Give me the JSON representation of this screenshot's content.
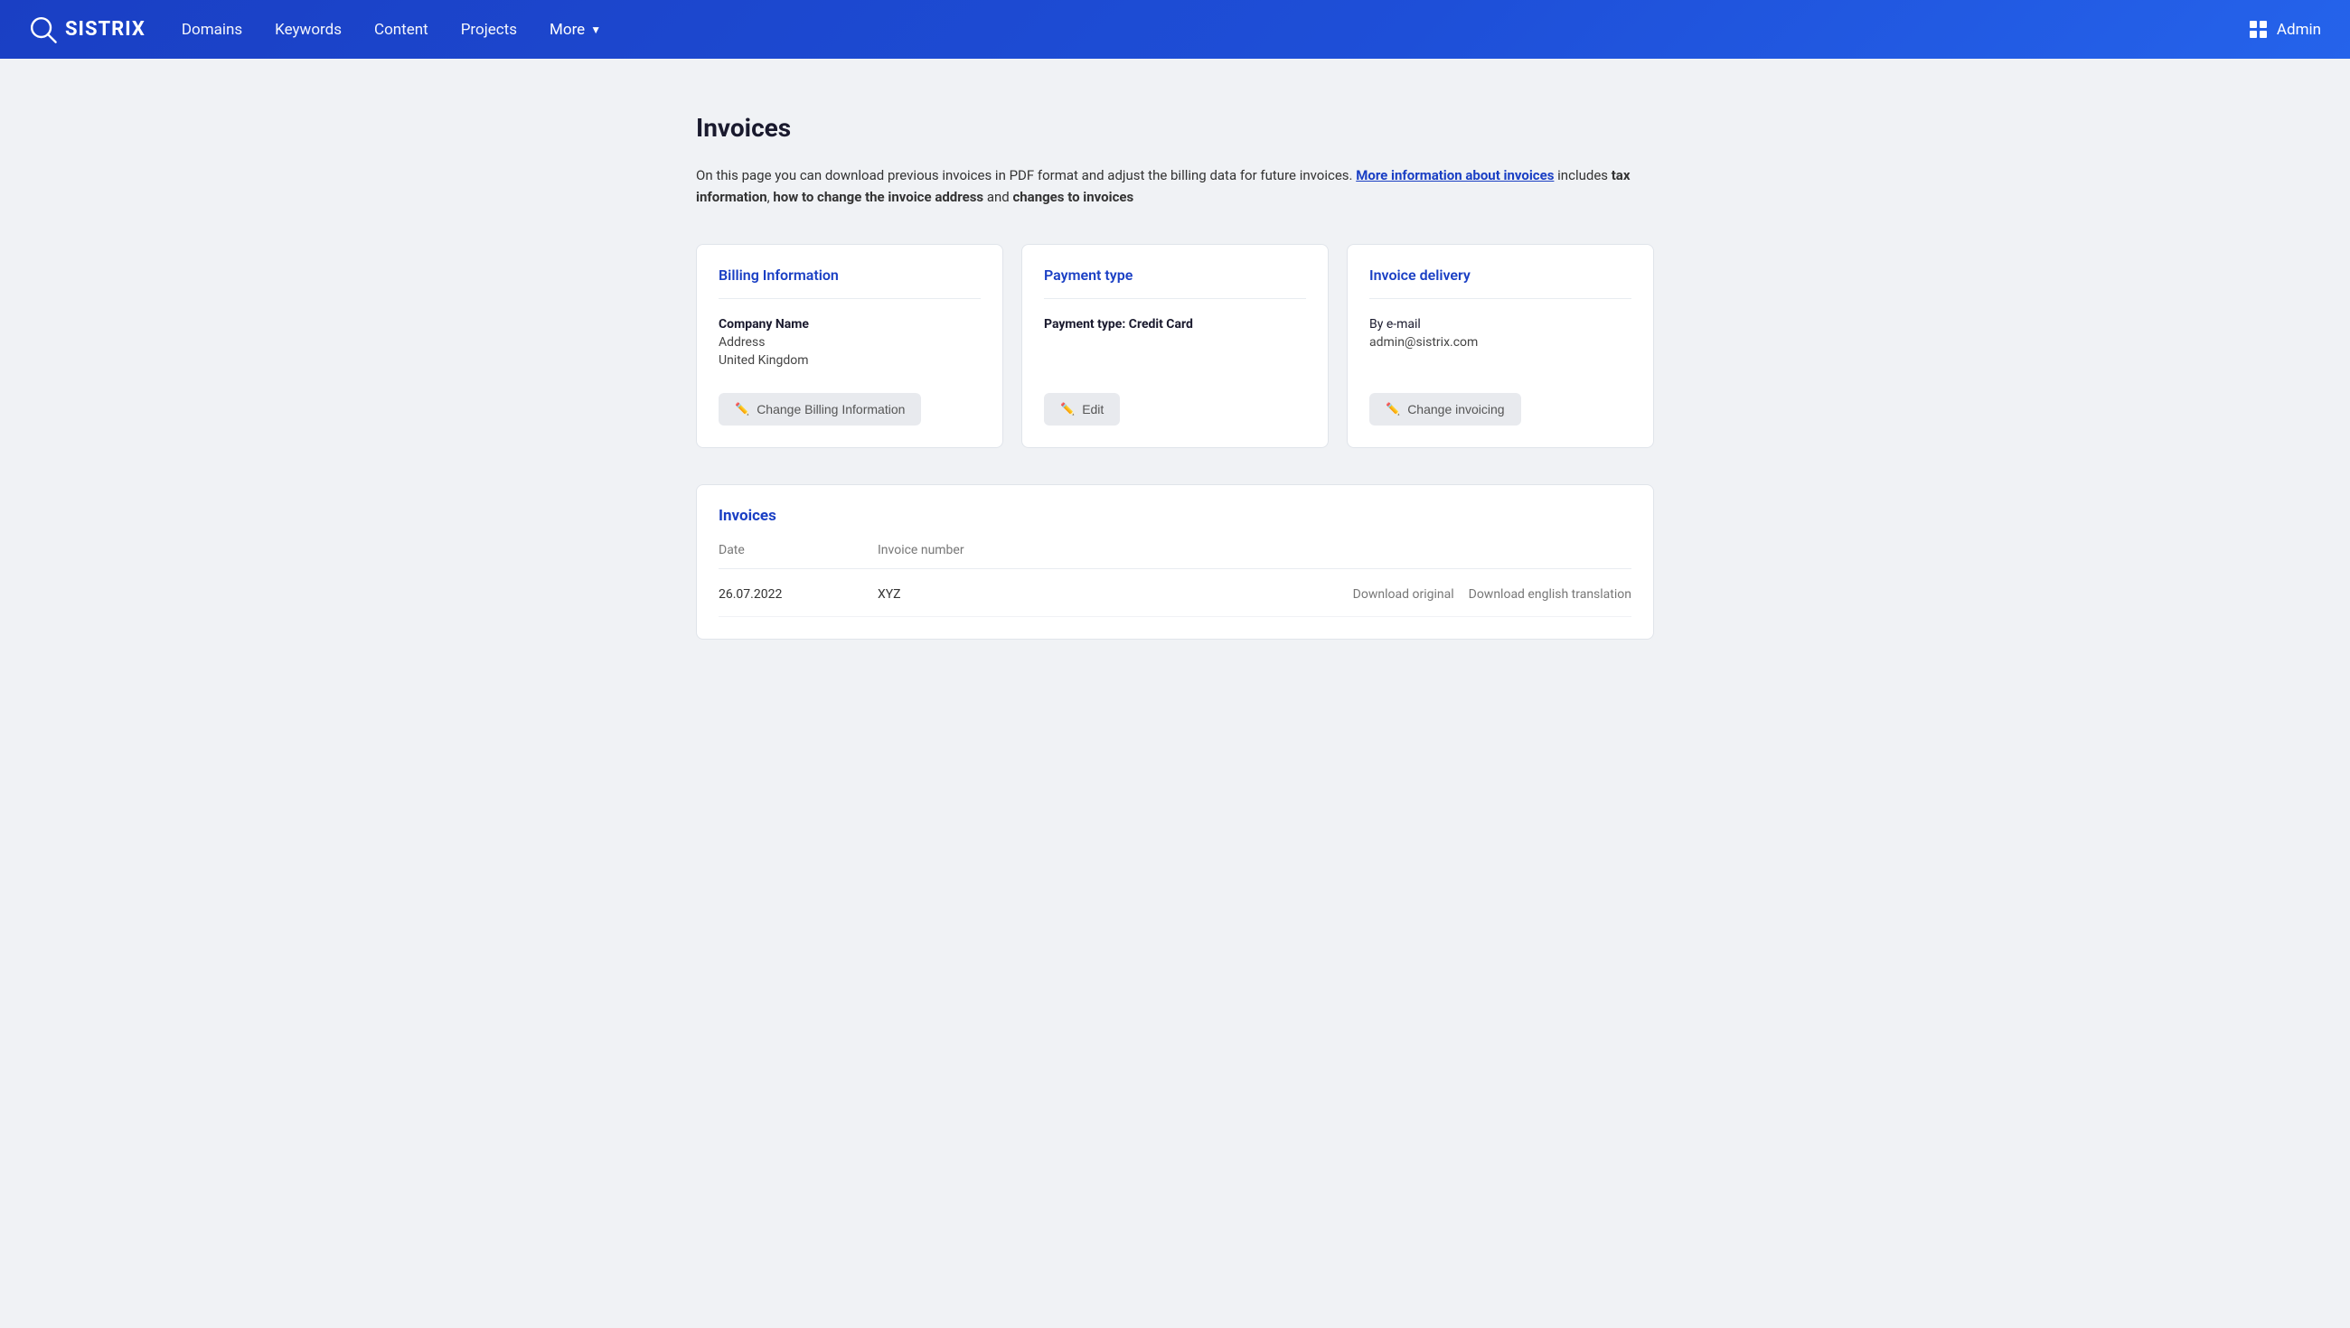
{
  "nav": {
    "logo_text": "SISTRIX",
    "links": [
      {
        "label": "Domains",
        "id": "domains"
      },
      {
        "label": "Keywords",
        "id": "keywords"
      },
      {
        "label": "Content",
        "id": "content"
      },
      {
        "label": "Projects",
        "id": "projects"
      }
    ],
    "more_label": "More",
    "admin_label": "Admin"
  },
  "page": {
    "title": "Invoices",
    "description_1": "On this page you can download previous invoices in PDF format and adjust the billing data for future invoices. ",
    "description_link": "More information about invoices",
    "description_2": " includes ",
    "desc_bold_1": "tax information",
    "desc_3": ", ",
    "desc_bold_2": "how to change the invoice address",
    "desc_4": " and ",
    "desc_bold_3": "changes to invoices"
  },
  "cards": {
    "billing": {
      "title": "Billing Information",
      "company_name": "Company Name",
      "address": "Address",
      "country": "United Kingdom",
      "button_label": "Change Billing Information"
    },
    "payment": {
      "title": "Payment type",
      "payment_type_label": "Payment type: Credit Card",
      "button_label": "Edit"
    },
    "delivery": {
      "title": "Invoice delivery",
      "delivery_method": "By e-mail",
      "email": "admin@sistrix.com",
      "button_label": "Change invoicing"
    }
  },
  "invoices_table": {
    "section_title": "Invoices",
    "columns": [
      "Date",
      "Invoice number"
    ],
    "rows": [
      {
        "date": "26.07.2022",
        "invoice_number": "XYZ",
        "download_original": "Download original",
        "download_translation": "Download english translation"
      }
    ]
  }
}
